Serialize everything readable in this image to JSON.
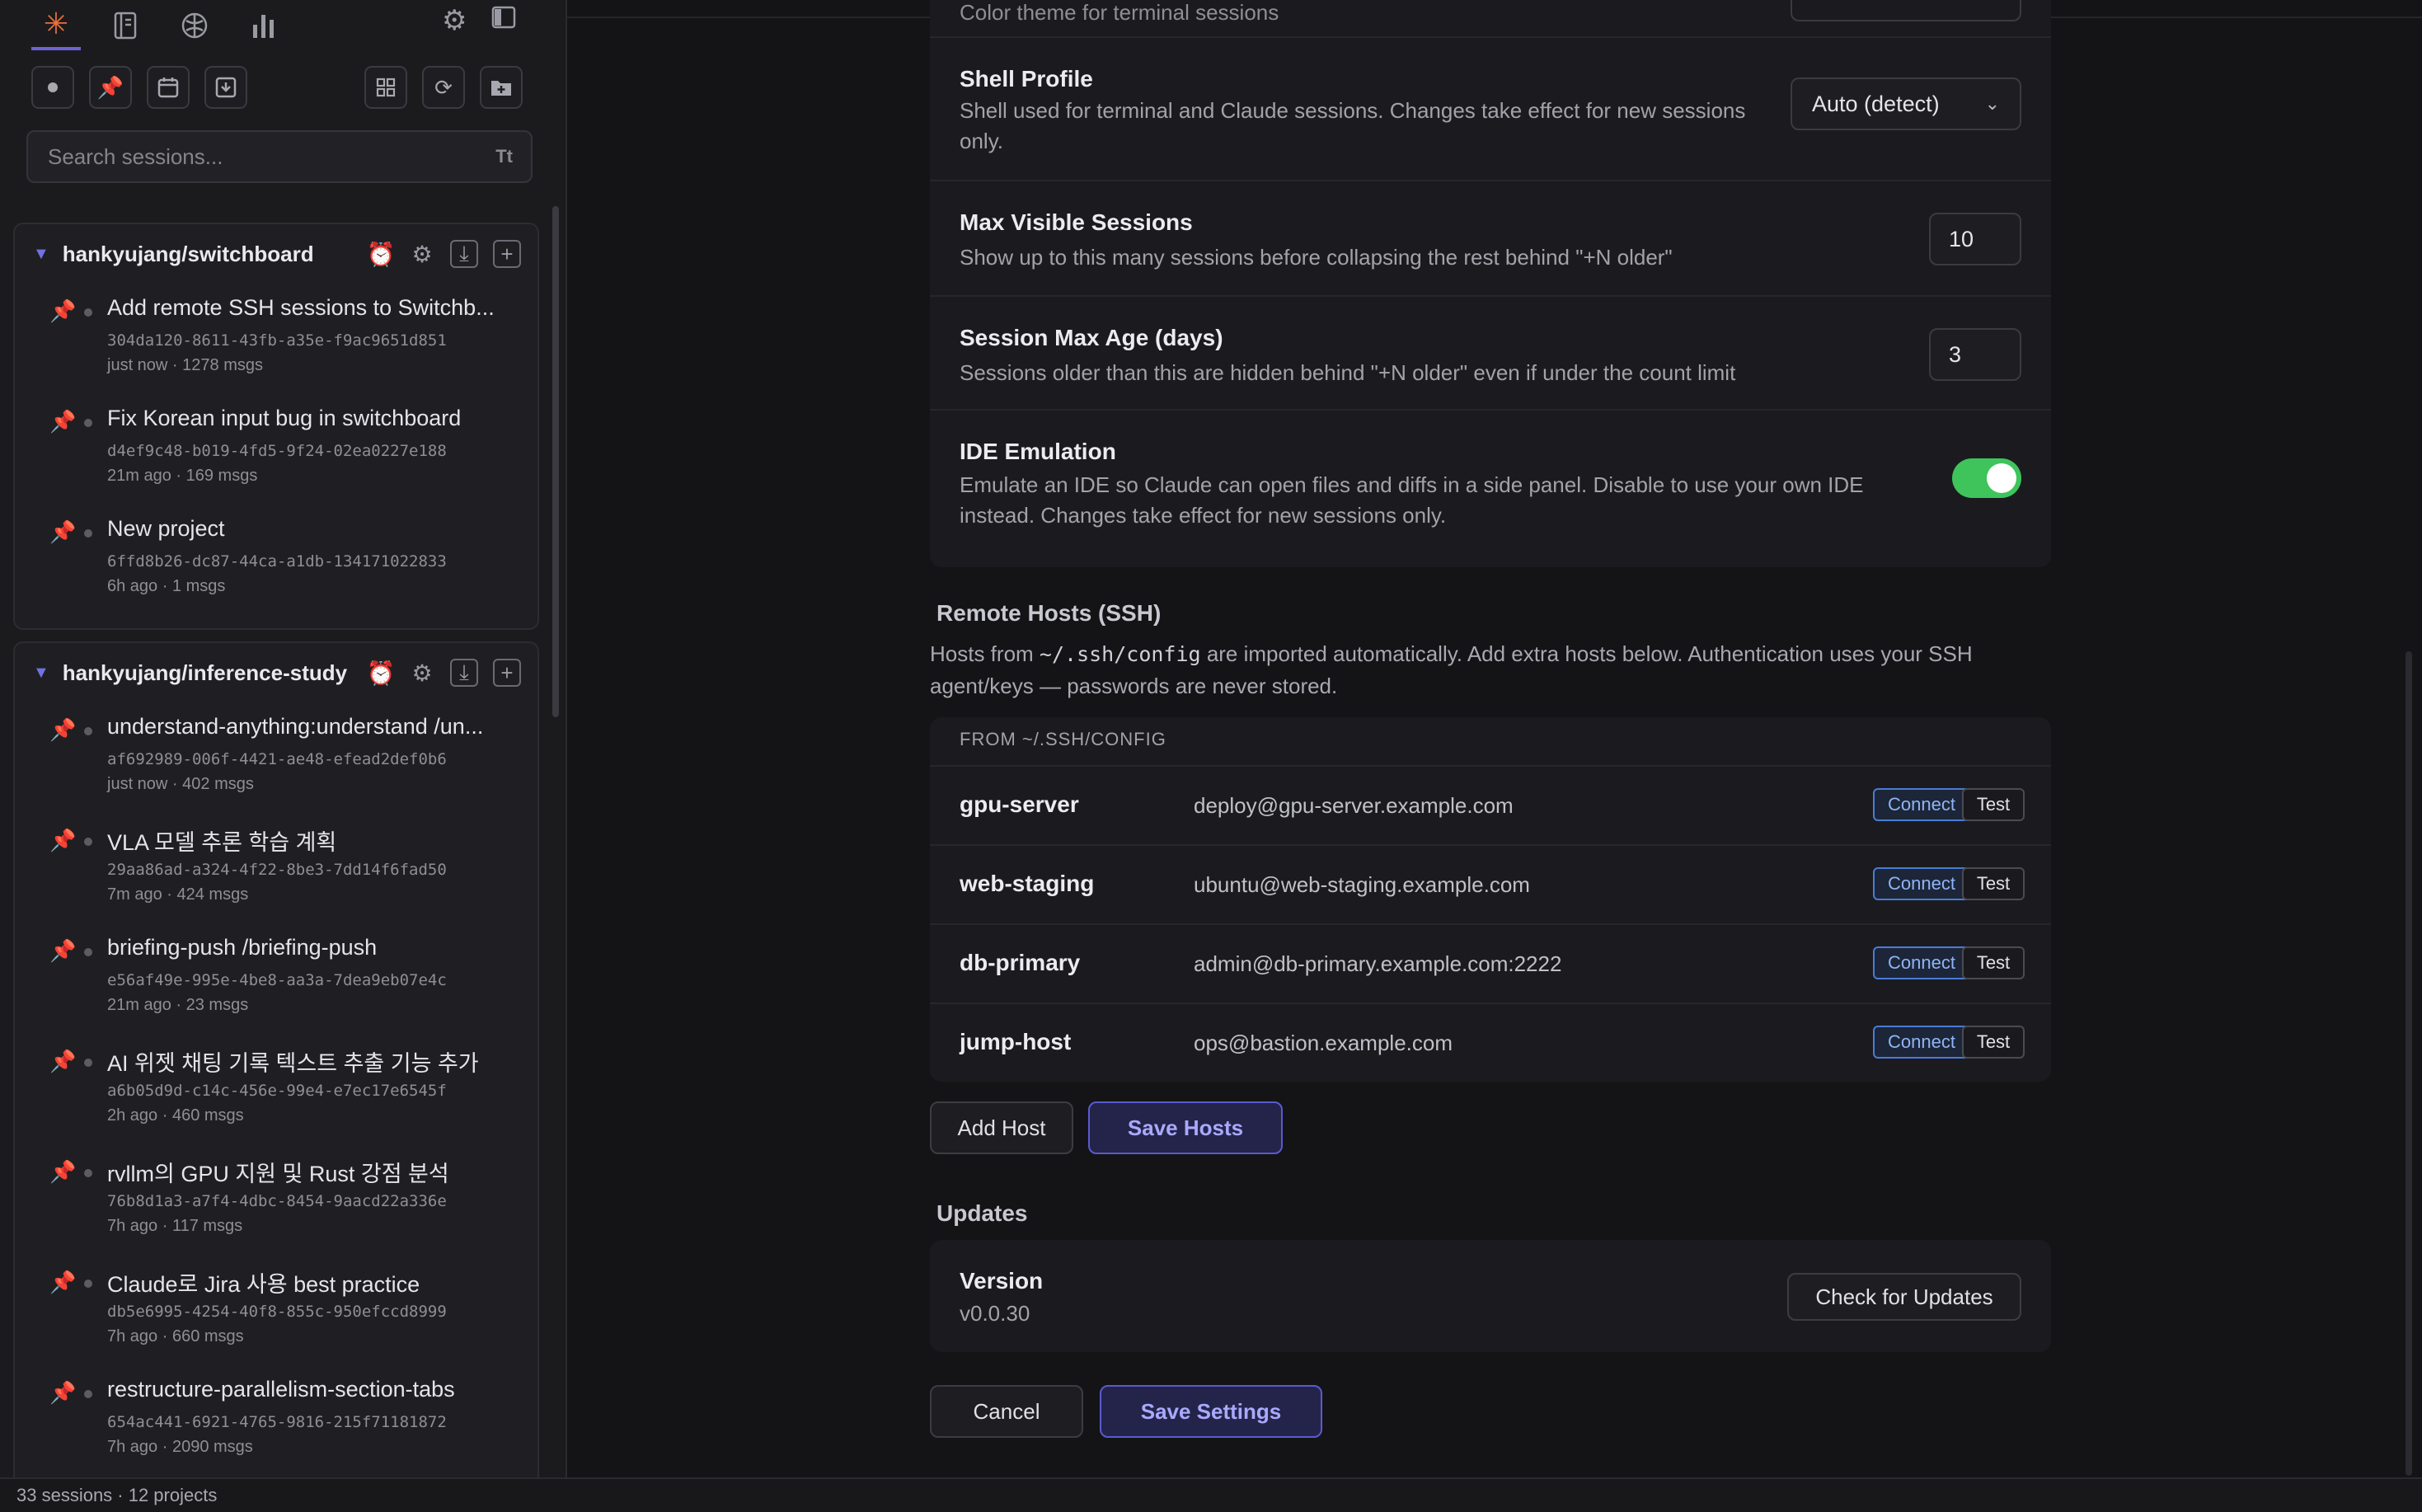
{
  "sidebar": {
    "search_placeholder": "Search sessions...",
    "search_hint": "Tt",
    "projects": [
      {
        "name": "hankyujang/switchboard",
        "sessions": [
          {
            "title": "Add remote SSH sessions to Switchb...",
            "id": "304da120-8611-43fb-a35e-f9ac9651d851",
            "meta": "just now · 1278 msgs"
          },
          {
            "title": "Fix Korean input bug in switchboard",
            "id": "d4ef9c48-b019-4fd5-9f24-02ea0227e188",
            "meta": "21m ago · 169 msgs"
          },
          {
            "title": "New project",
            "id": "6ffd8b26-dc87-44ca-a1db-134171022833",
            "meta": "6h ago · 1 msgs"
          }
        ]
      },
      {
        "name": "hankyujang/inference-study",
        "sessions": [
          {
            "title": "understand-anything:understand /un...",
            "id": "af692989-006f-4421-ae48-efead2def0b6",
            "meta": "just now · 402 msgs"
          },
          {
            "title": "VLA 모델 추론 학습 계획",
            "id": "29aa86ad-a324-4f22-8be3-7dd14f6fad50",
            "meta": "7m ago · 424 msgs"
          },
          {
            "title": "briefing-push /briefing-push",
            "id": "e56af49e-995e-4be8-aa3a-7dea9eb07e4c",
            "meta": "21m ago · 23 msgs"
          },
          {
            "title": "AI 위젯 채팅 기록 텍스트 추출 기능 추가",
            "id": "a6b05d9d-c14c-456e-99e4-e7ec17e6545f",
            "meta": "2h ago · 460 msgs"
          },
          {
            "title": "rvllm의 GPU 지원 및 Rust 강점 분석",
            "id": "76b8d1a3-a7f4-4dbc-8454-9aacd22a336e",
            "meta": "7h ago · 117 msgs"
          },
          {
            "title": "Claude로 Jira 사용 best practice",
            "id": "db5e6995-4254-40f8-855c-950efccd8999",
            "meta": "7h ago · 660 msgs"
          },
          {
            "title": "restructure-parallelism-section-tabs",
            "id": "654ac441-6921-4765-9816-215f71181872",
            "meta": "7h ago · 2090 msgs"
          }
        ]
      }
    ],
    "footer": "33 sessions · 12 projects"
  },
  "settings": {
    "partial_top_text": "Color theme for terminal sessions",
    "shell_profile": {
      "label": "Shell Profile",
      "desc": "Shell used for terminal and Claude sessions. Changes take effect for new sessions only.",
      "value": "Auto (detect)"
    },
    "max_visible": {
      "label": "Max Visible Sessions",
      "desc": "Show up to this many sessions before collapsing the rest behind \"+N older\"",
      "value": "10"
    },
    "max_age": {
      "label": "Session Max Age (days)",
      "desc": "Sessions older than this are hidden behind \"+N older\" even if under the count limit",
      "value": "3"
    },
    "ide": {
      "label": "IDE Emulation",
      "desc": "Emulate an IDE so Claude can open files and diffs in a side panel. Disable to use your own IDE instead. Changes take effect for new sessions only.",
      "enabled": true
    }
  },
  "remote": {
    "title": "Remote Hosts (SSH)",
    "desc_pre": "Hosts from ",
    "desc_code": "~/.ssh/config",
    "desc_post": " are imported automatically. Add extra hosts below. Authentication uses your SSH agent/keys — passwords are never stored.",
    "group_label": "FROM ~/.SSH/CONFIG",
    "connect_label": "Connect",
    "test_label": "Test",
    "hosts": [
      {
        "name": "gpu-server",
        "address": "deploy@gpu-server.example.com"
      },
      {
        "name": "web-staging",
        "address": "ubuntu@web-staging.example.com"
      },
      {
        "name": "db-primary",
        "address": "admin@db-primary.example.com:2222"
      },
      {
        "name": "jump-host",
        "address": "ops@bastion.example.com"
      }
    ],
    "add_host": "Add Host",
    "save_hosts": "Save Hosts"
  },
  "updates": {
    "title": "Updates",
    "version_label": "Version",
    "version_value": "v0.0.30",
    "check_button": "Check for Updates"
  },
  "actions": {
    "cancel": "Cancel",
    "save": "Save Settings"
  },
  "colors": {
    "accent": "#5a5ad0",
    "toggle_on": "#3ec45b",
    "brand": "#e8703a"
  }
}
